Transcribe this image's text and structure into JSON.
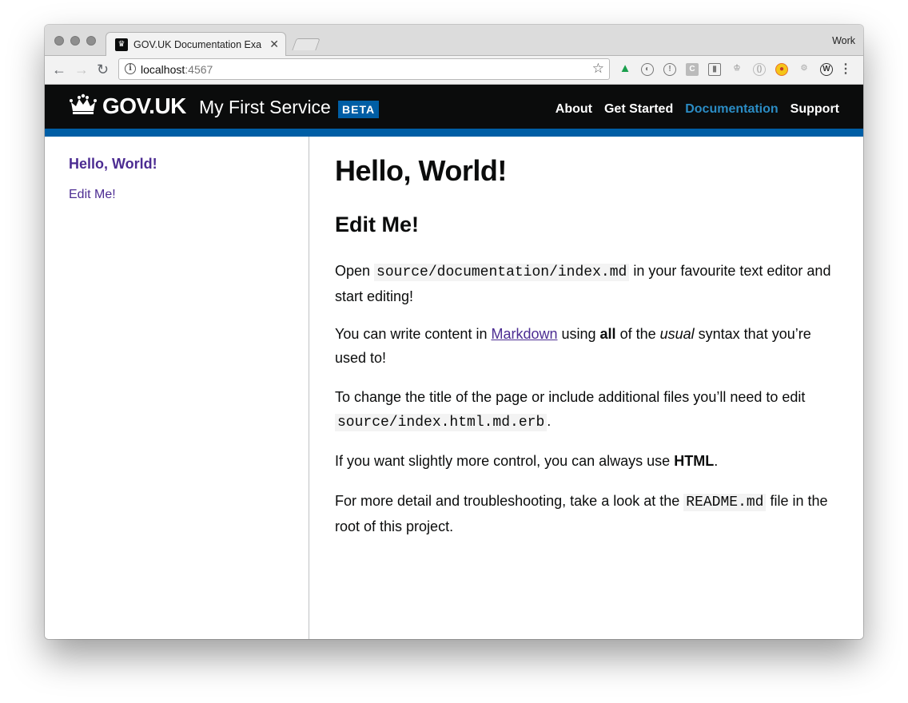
{
  "browser": {
    "tab_title": "GOV.UK Documentation Example",
    "profile": "Work",
    "url_host": "localhost",
    "url_port": ":4567"
  },
  "header": {
    "logo_text": "GOV.UK",
    "service_name": "My First Service",
    "phase_tag": "BETA",
    "nav": [
      "About",
      "Get Started",
      "Documentation",
      "Support"
    ],
    "active_nav": "Documentation"
  },
  "sidebar": {
    "heading": "Hello, World!",
    "link": "Edit Me!"
  },
  "content": {
    "h1": "Hello, World!",
    "h2": "Edit Me!",
    "p1_before": "Open ",
    "p1_code": "source/documentation/index.md",
    "p1_after": " in your favourite text editor and start editing!",
    "p2_before": "You can write content in ",
    "p2_link": "Markdown",
    "p2_mid1": " using ",
    "p2_bold": "all",
    "p2_mid2": " of the ",
    "p2_italic": "usual",
    "p2_after": " syntax that you’re used to!",
    "p3_before": "To change the title of the page or include additional files you’ll need to edit ",
    "p3_code": "source/index.html.md.erb",
    "p3_after": ".",
    "p4_before": "If you want slightly more control, you can always use ",
    "p4_bold": "HTML",
    "p4_after": ".",
    "p5_before": "For more detail and troubleshooting, take a look at the ",
    "p5_code": "README.md",
    "p5_after": " file in the root of this project."
  },
  "colors": {
    "header_bg": "#0b0c0c",
    "header_bar": "#005ea5",
    "link": "#4c2c92",
    "nav_active": "#2b8cc4"
  }
}
